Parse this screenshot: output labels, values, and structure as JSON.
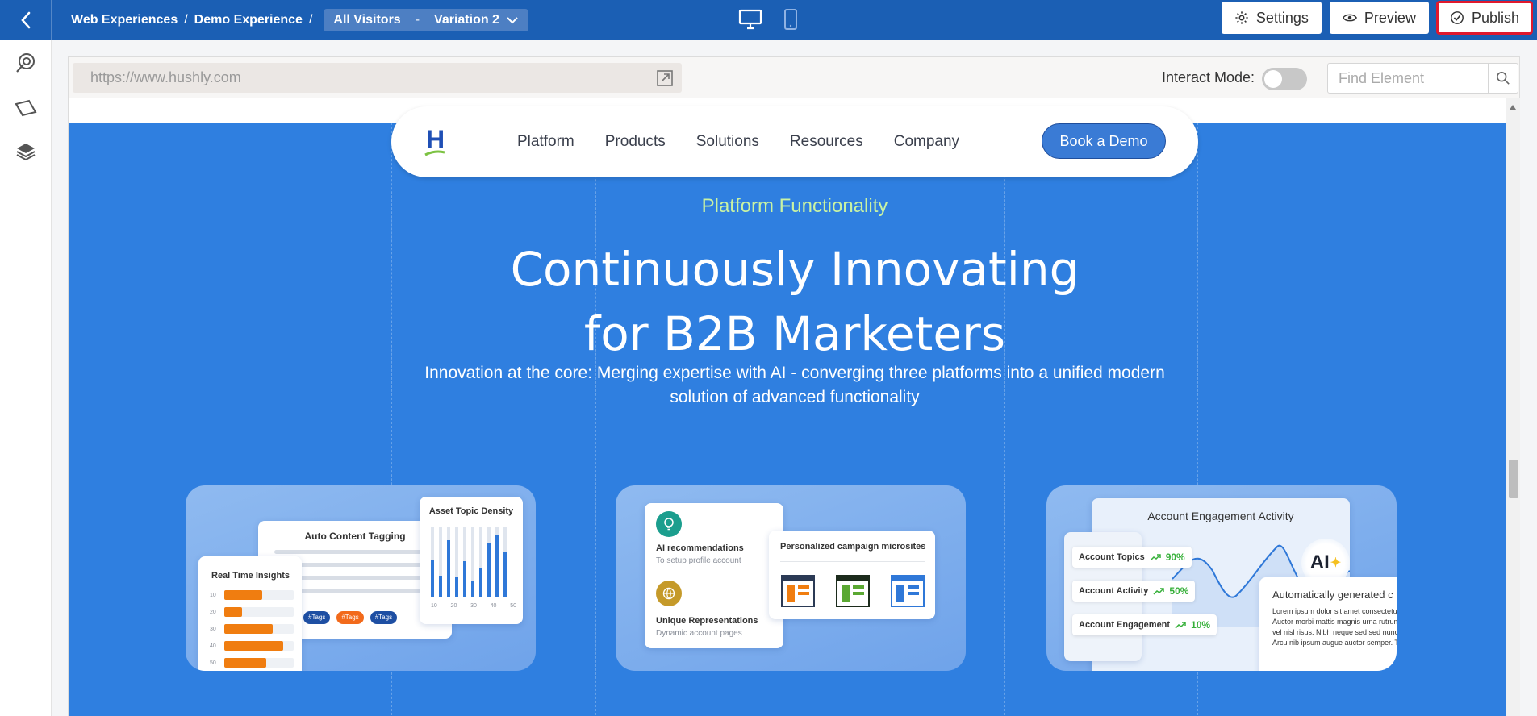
{
  "breadcrumb": {
    "items": [
      "Web Experiences",
      "Demo Experience"
    ],
    "separator": "/",
    "audience": "All Visitors",
    "dash": "-",
    "variation": "Variation 2"
  },
  "toolbar": {
    "settings_label": "Settings",
    "preview_label": "Preview",
    "publish_label": "Publish"
  },
  "browser": {
    "url": "https://www.hushly.com",
    "interact_label": "Interact Mode:",
    "interact_on": false,
    "find_placeholder": "Find Element"
  },
  "site": {
    "logo_letter": "H",
    "nav": [
      "Platform",
      "Products",
      "Solutions",
      "Resources",
      "Company"
    ],
    "cta": "Book a Demo",
    "eyebrow": "Platform Functionality",
    "headline_line1": "Continuously Innovating",
    "headline_line2": "for B2B Marketers",
    "subhead": "Innovation at the core: Merging expertise with AI - converging three platforms into a unified modern solution of advanced functionality"
  },
  "card1": {
    "content_tagging_title": "Auto Content Tagging",
    "tags": [
      "#Tags",
      "#Tags",
      "#Tags"
    ],
    "density_title": "Asset Topic Density",
    "density_ticks": [
      "10",
      "20",
      "30",
      "40",
      "50"
    ],
    "insights_title": "Real Time Insights",
    "insights_rows": [
      {
        "label": "10",
        "value": 0.55
      },
      {
        "label": "20",
        "value": 0.25
      },
      {
        "label": "30",
        "value": 0.7
      },
      {
        "label": "40",
        "value": 0.85
      },
      {
        "label": "50",
        "value": 0.6
      }
    ]
  },
  "card2": {
    "ai_title": "AI recommendations",
    "ai_sub": "To setup profile account",
    "unique_title": "Unique Representations",
    "unique_sub": "Dynamic account pages",
    "micro_title": "Personalized campaign microsites"
  },
  "card3": {
    "title": "Account Engagement Activity",
    "rows": [
      {
        "label": "Account Topics",
        "pct": "90%"
      },
      {
        "label": "Account Activity",
        "pct": "50%"
      },
      {
        "label": "Account Engagement",
        "pct": "10%"
      }
    ],
    "ai_badge": "AI",
    "generated_title": "Automatically generated c",
    "generated_body": "Lorem ipsum dolor sit amet consectetur. Auctor morbi mattis magnis urna rutrum vel nisl risus. Nibh neque sed sed nunc. Arcu nib ipsum augue auctor semper. Tell"
  },
  "colors": {
    "topbar": "#1b5fb4",
    "hero": "#2f7fe0",
    "eyebrow": "#c9f3a3",
    "publish_outline": "#e0192d",
    "tag_blue": "#1e4fa3",
    "tag_orange": "#f26a1b",
    "bar_orange": "#f07d10"
  }
}
